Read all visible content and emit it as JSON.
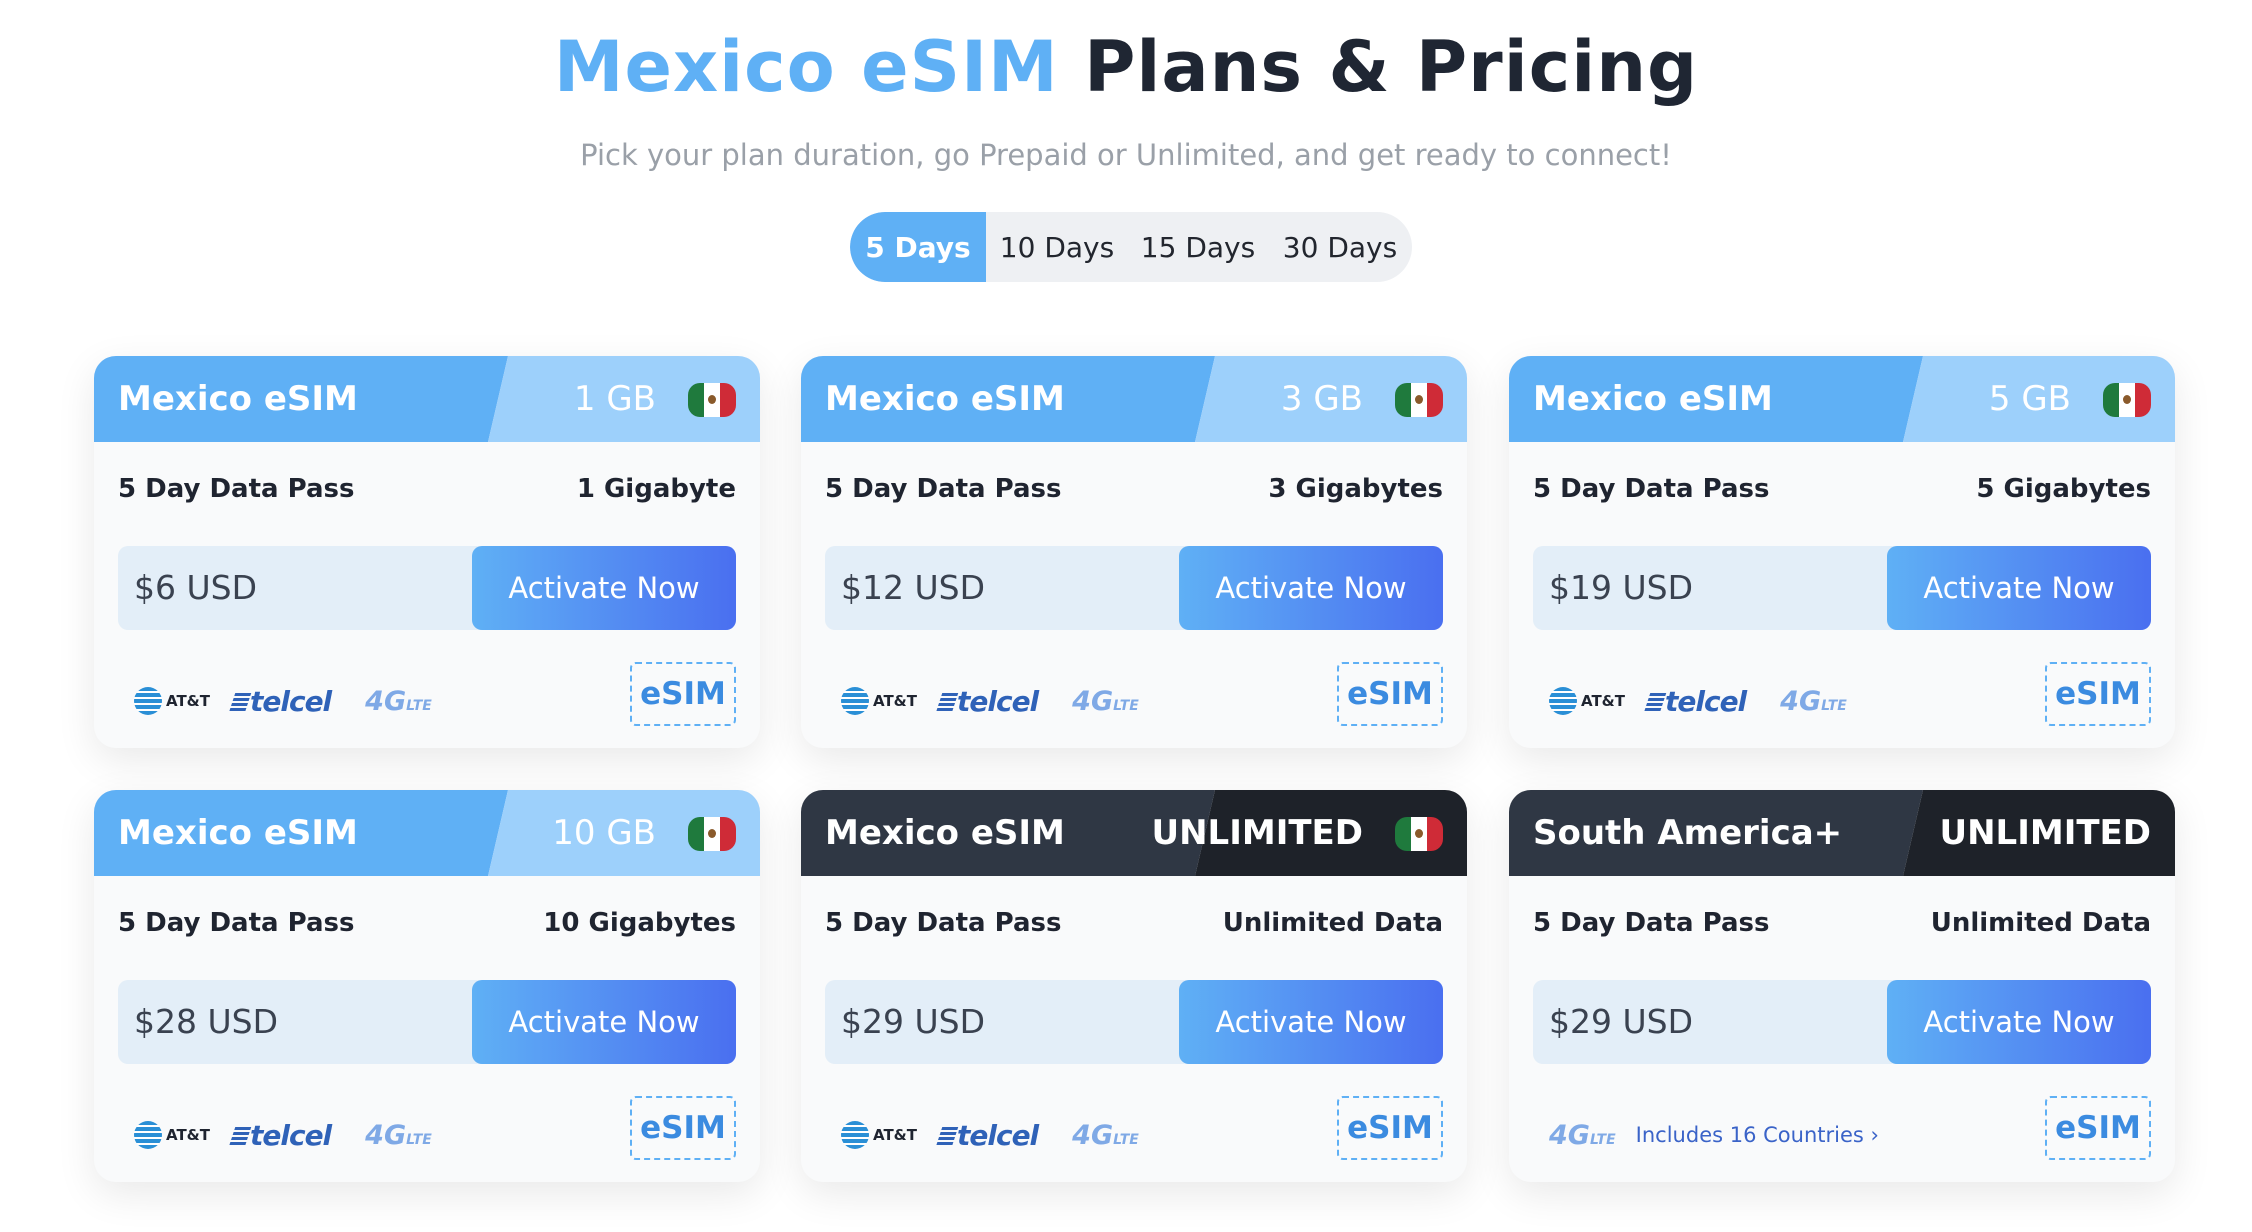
{
  "header": {
    "title_accent": "Mexico eSIM",
    "title_rest": "Plans & Pricing",
    "subtitle": "Pick your plan duration, go Prepaid or Unlimited, and get ready to connect!"
  },
  "tabs": [
    {
      "label": "5 Days",
      "active": true
    },
    {
      "label": "10 Days",
      "active": false
    },
    {
      "label": "15 Days",
      "active": false
    },
    {
      "label": "30 Days",
      "active": false
    }
  ],
  "colors": {
    "accent": "#5fb0f5",
    "accent_light": "#9dd0fb",
    "dark_header": "#2f3744",
    "button_gradient_end": "#4a6ff0"
  },
  "carriers": {
    "att": "AT&T",
    "telcel": "telcel",
    "lte_main": "4G",
    "lte_sub": "LTE",
    "esim": "eSIM"
  },
  "cards": [
    {
      "name": "Mexico eSIM",
      "size": "1 GB",
      "pass": "5 Day Data Pass",
      "data": "1 Gigabyte",
      "price": "$6 USD",
      "button": "Activate Now",
      "theme": "light",
      "flag": "mexico-flag-icon"
    },
    {
      "name": "Mexico eSIM",
      "size": "3 GB",
      "pass": "5 Day Data Pass",
      "data": "3 Gigabytes",
      "price": "$12 USD",
      "button": "Activate Now",
      "theme": "light",
      "flag": "mexico-flag-icon"
    },
    {
      "name": "Mexico eSIM",
      "size": "5 GB",
      "pass": "5 Day Data Pass",
      "data": "5 Gigabytes",
      "price": "$19 USD",
      "button": "Activate Now",
      "theme": "light",
      "flag": "mexico-flag-icon"
    },
    {
      "name": "Mexico eSIM",
      "size": "10 GB",
      "pass": "5 Day Data Pass",
      "data": "10 Gigabytes",
      "price": "$28 USD",
      "button": "Activate Now",
      "theme": "light",
      "flag": "mexico-flag-icon"
    },
    {
      "name": "Mexico eSIM",
      "size": "UNLIMITED",
      "pass": "5 Day Data Pass",
      "data": "Unlimited Data",
      "price": "$29 USD",
      "button": "Activate Now",
      "theme": "dark",
      "flag": "mexico-flag-icon"
    },
    {
      "name": "South America+",
      "size": "UNLIMITED",
      "pass": "5 Day Data Pass",
      "data": "Unlimited Data",
      "price": "$29 USD",
      "button": "Activate Now",
      "theme": "dark",
      "countries_link": "Includes 16 Countries ›"
    }
  ]
}
